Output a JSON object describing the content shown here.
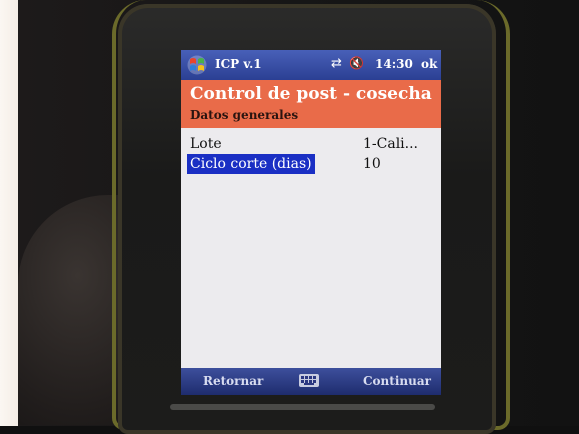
{
  "status_bar": {
    "app_name": "ICP v.1",
    "time": "14:30",
    "ok_label": "ok",
    "icons": [
      "windows-start-icon",
      "connectivity-icon",
      "speaker-muted-icon"
    ]
  },
  "header": {
    "title": "Control de post - cosecha",
    "subtitle": "Datos generales"
  },
  "form": {
    "rows": [
      {
        "label": "Lote",
        "value": "1-Cali..."
      },
      {
        "label": "Ciclo corte (dias)",
        "value": "10"
      }
    ]
  },
  "softkeys": {
    "left": "Retornar",
    "right": "Continuar"
  },
  "colors": {
    "status_bar": "#2b3f93",
    "header": "#e96b49",
    "selection": "#1a2fc4",
    "screen_background": "#ecebee"
  }
}
